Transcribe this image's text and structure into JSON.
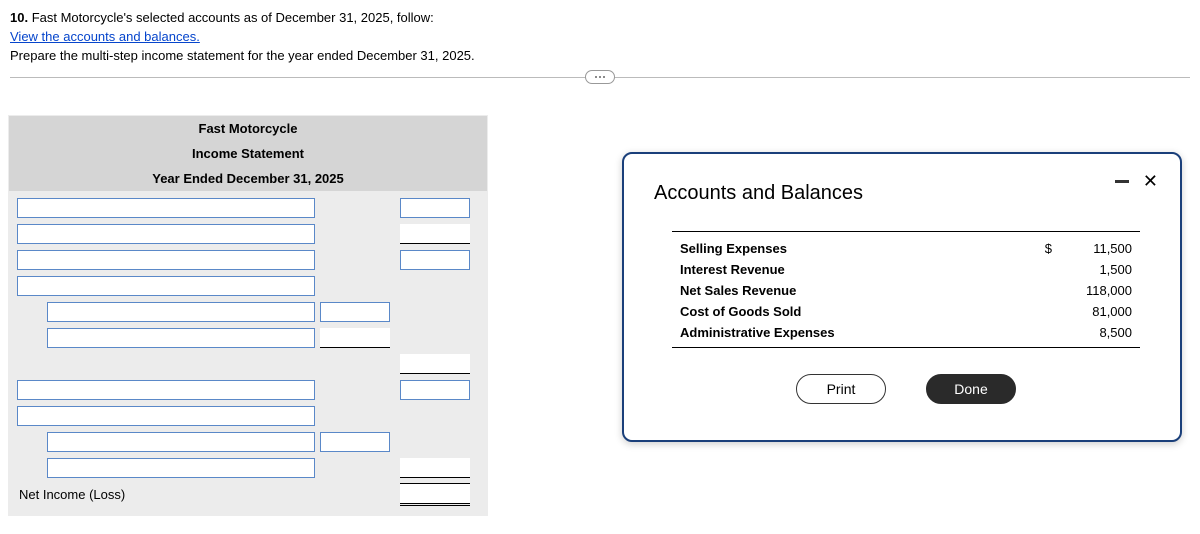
{
  "header": {
    "q_num": "10.",
    "q_text": "Fast Motorcycle's selected accounts as of December 31, 2025, follow:",
    "link_text": "View the accounts and balances.",
    "instr": "Prepare the multi-step income statement for the year ended December 31, 2025."
  },
  "worksheet": {
    "h1": "Fast Motorcycle",
    "h2": "Income Statement",
    "h3": "Year Ended December 31, 2025",
    "net_income_label": "Net Income (Loss)"
  },
  "modal": {
    "title": "Accounts and Balances",
    "currency": "$",
    "accounts": [
      {
        "name": "Selling Expenses",
        "value": "11,500"
      },
      {
        "name": "Interest Revenue",
        "value": "1,500"
      },
      {
        "name": "Net Sales Revenue",
        "value": "118,000"
      },
      {
        "name": "Cost of Goods Sold",
        "value": "81,000"
      },
      {
        "name": "Administrative Expenses",
        "value": "8,500"
      }
    ],
    "print": "Print",
    "done": "Done"
  }
}
